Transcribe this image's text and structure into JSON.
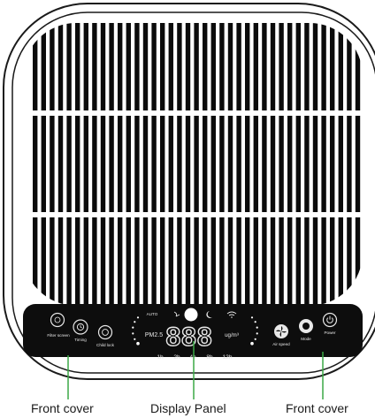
{
  "panel": {
    "left_buttons": [
      {
        "name": "filter-screen",
        "label": "Filter screen"
      },
      {
        "name": "timing",
        "label": "Timing"
      },
      {
        "name": "child-lock",
        "label": "Child lock"
      }
    ],
    "right_buttons": [
      {
        "name": "air-speed",
        "label": "Air speed"
      },
      {
        "name": "mode",
        "label": "Mode"
      },
      {
        "name": "power",
        "label": "Power"
      }
    ],
    "display": {
      "auto": "AUTO",
      "pm": "PM2.5",
      "digits": "888",
      "unit": "ug/m³",
      "timers": [
        "1h",
        "2h",
        "4h",
        "8h",
        "12h"
      ]
    }
  },
  "callouts": {
    "left": "Front cover",
    "center": "Display Panel",
    "right": "Front cover"
  },
  "colors": {
    "outline": "#1a1a1a",
    "panel": "#0d0d0d",
    "callout_line": "#3aa845",
    "panel_text": "#e8e8e8",
    "dots": "#ffffff"
  }
}
